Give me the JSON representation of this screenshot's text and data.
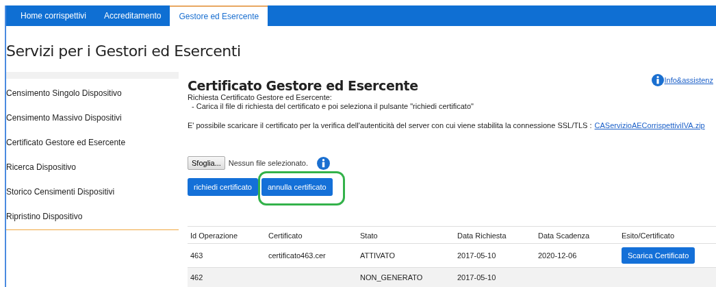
{
  "nav": {
    "tabs": [
      {
        "label": "Home corrispettivi",
        "selected": false
      },
      {
        "label": "Accreditamento",
        "selected": false
      },
      {
        "label": "Gestore ed Esercente",
        "selected": true
      }
    ]
  },
  "page_title": "Servizi per i Gestori ed Esercenti",
  "sidebar": {
    "items": [
      {
        "label": "Censimento Singolo Dispositivo"
      },
      {
        "label": "Censimento Massivo Dispositivi"
      },
      {
        "label": "Certificato Gestore ed Esercente"
      },
      {
        "label": "Ricerca Dispositivo"
      },
      {
        "label": "Storico Censimenti Dispositivi"
      },
      {
        "label": "Ripristino Dispositivo"
      }
    ]
  },
  "main": {
    "title": "Certificato Gestore ed Esercente",
    "help_link": "Info&assistenz",
    "intro": "Richiesta Certificato Gestore ed Esercente:",
    "instruction": "- Carica il file di richiesta del certificato e poi seleziona il pulsante \"richiedi certificato\"",
    "download_text": "E' possibile scaricare il certificato per la verifica dell'autenticità del server con cui viene stabilita la connessione SSL/TLS :",
    "download_link": "CAServizioAECorrispettiviIVA.zip",
    "file_input": {
      "button": "Sfoglia...",
      "status": "Nessun file selezionato."
    },
    "buttons": [
      {
        "label": "richiedi certificato",
        "highlighted": false
      },
      {
        "label": "annulla certificato",
        "highlighted": true
      }
    ],
    "table": {
      "columns": [
        "Id Operazione",
        "Certificato",
        "Stato",
        "Data Richiesta",
        "Data Scadenza",
        "Esito/Certificato"
      ],
      "rows": [
        {
          "cells": [
            "463",
            "certificato463.cer",
            "ATTIVATO",
            "2017-05-10",
            "2020-12-06"
          ],
          "action": "Scarica Certificato"
        },
        {
          "cells": [
            "462",
            "",
            "NON_GENERATO",
            "2017-05-10",
            ""
          ]
        }
      ]
    }
  }
}
